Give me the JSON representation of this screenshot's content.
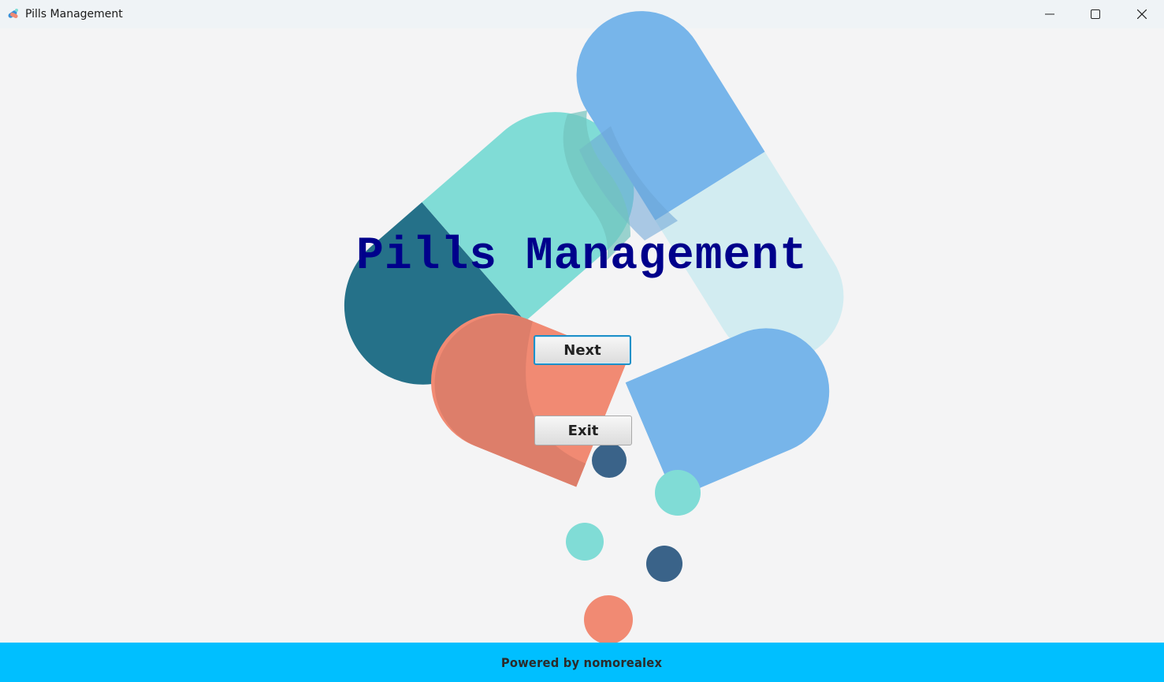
{
  "window": {
    "title": "Pills Management",
    "icon": "pills-app-icon",
    "controls": {
      "minimize_icon": "minimize-icon",
      "maximize_icon": "maximize-icon",
      "close_icon": "close-icon"
    }
  },
  "main": {
    "title": "Pills Management",
    "next_label": "Next",
    "exit_label": "Exit"
  },
  "footer": {
    "text": "Powered by nomorealex"
  },
  "colors": {
    "title_text": "#00008b",
    "footer_background": "#00bfff",
    "focus_border": "#1e90c8",
    "pill_teal": "#80dcd6",
    "pill_dark_teal": "#257189",
    "pill_salmon": "#f18a73",
    "pill_blue": "#77b5ea",
    "pill_light_blue": "#d2ecf1",
    "dot_navy": "#3a6389"
  }
}
